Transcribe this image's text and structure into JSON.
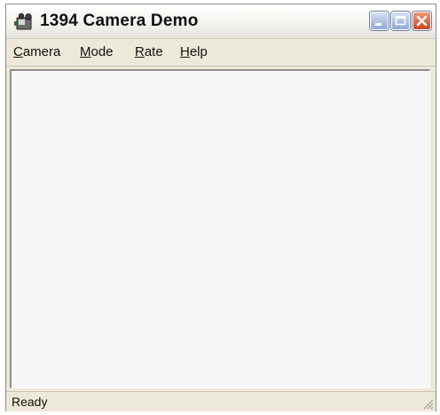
{
  "window": {
    "title": "1394 Camera Demo",
    "icon": "camera-app-icon",
    "controls": [
      "minimize-icon",
      "maximize-icon",
      "close-icon"
    ]
  },
  "menu": {
    "items": [
      {
        "label": "Camera",
        "mnemonic": "C"
      },
      {
        "label": "Mode",
        "mnemonic": "M"
      },
      {
        "label": "Rate",
        "mnemonic": "R"
      },
      {
        "label": "Help",
        "mnemonic": "H"
      }
    ]
  },
  "status": {
    "text": "Ready"
  },
  "colors": {
    "window_frame": "#ece9d8",
    "client_area": "#f6f6f8",
    "close_button": "#c9451d"
  }
}
